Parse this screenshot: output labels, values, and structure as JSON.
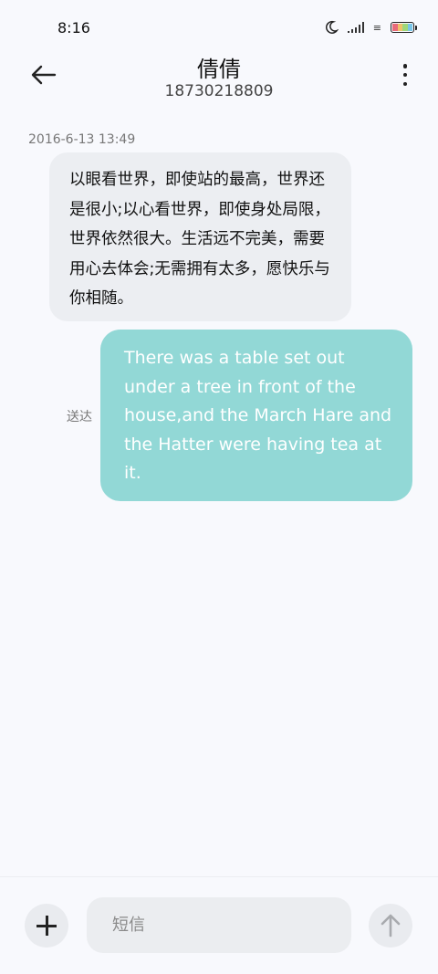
{
  "status_bar": {
    "time": "8:16",
    "network_label": "≡",
    "battery_colors": [
      "#e96b7a",
      "#f0c36a",
      "#9fd87a",
      "#79c6e8"
    ]
  },
  "header": {
    "contact_name": "倩倩",
    "phone_number": "18730218809"
  },
  "conversation": {
    "timestamp": "2016-6-13 13:49",
    "incoming_message": "以眼看世界，即使站的最高，世界还是很小;以心看世界，即使身处局限，世界依然很大。生活远不完美，需要用心去体会;无需拥有太多，愿快乐与你相随。",
    "outgoing_message": "There was a table set out under a tree in front of the house,and the March Hare and the Hatter were having tea at it.",
    "delivery_status": "送达"
  },
  "composer": {
    "placeholder": "短信"
  },
  "colors": {
    "background": "#f8f9fd",
    "incoming_bubble": "#eceef2",
    "outgoing_bubble": "#92d8d6"
  },
  "icons": {
    "back": "arrow-left-icon",
    "more": "more-vertical-icon",
    "add": "plus-icon",
    "send": "arrow-up-icon"
  }
}
